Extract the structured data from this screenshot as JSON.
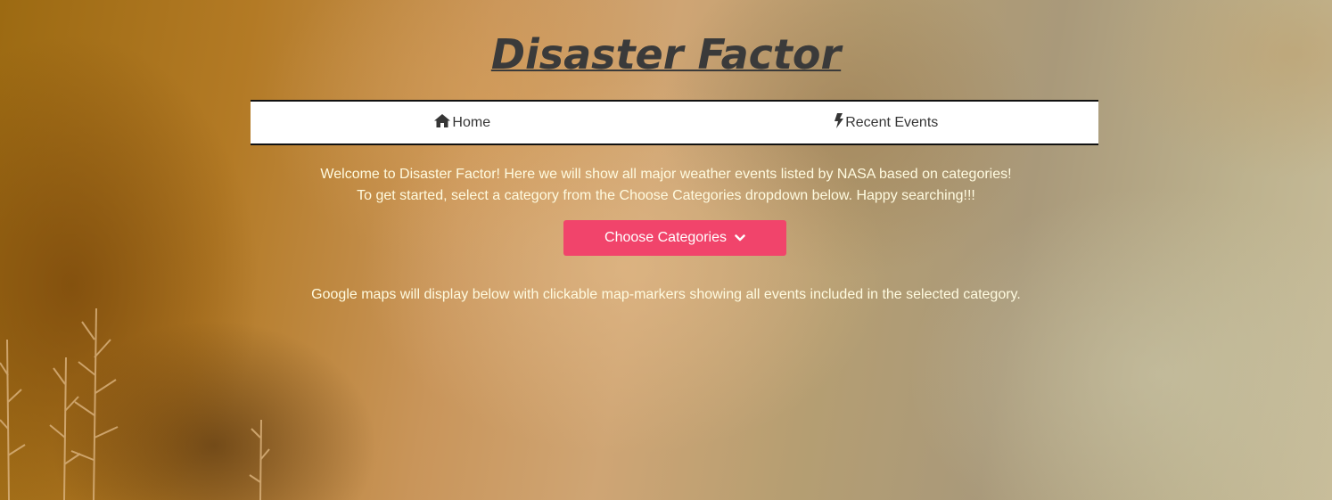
{
  "header": {
    "title": "Disaster Factor"
  },
  "nav": {
    "items": [
      {
        "label": "Home",
        "icon": "home-icon"
      },
      {
        "label": "Recent Events",
        "icon": "lightning-bolt-icon"
      }
    ]
  },
  "intro": {
    "line1": "Welcome to Disaster Factor! Here we will show all major weather events listed by NASA based on categories!",
    "line2": "To get started, select a category from the Choose Categories dropdown below. Happy searching!!!"
  },
  "dropdown": {
    "label": "Choose Categories",
    "icon": "chevron-down-icon",
    "color": "#f1446b"
  },
  "maps_note": "Google maps will display below with clickable map-markers showing all events included in the selected category.",
  "colors": {
    "title": "#3a3a3a",
    "text": "#fffbe0",
    "navbar_bg": "#ffffff"
  }
}
